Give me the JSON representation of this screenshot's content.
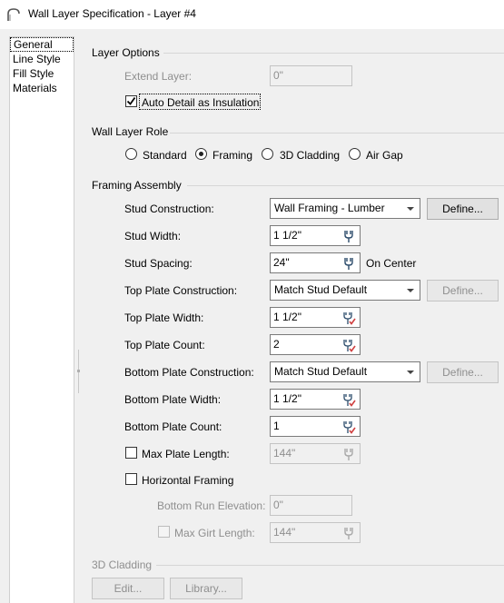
{
  "window": {
    "title": "Wall Layer Specification - Layer #4"
  },
  "nav": {
    "items": [
      "General",
      "Line Style",
      "Fill Style",
      "Materials"
    ],
    "selected": "General"
  },
  "layer_options": {
    "title": "Layer Options",
    "extend_layer_label": "Extend Layer:",
    "extend_layer_value": "0\"",
    "auto_detail_label": "Auto Detail as Insulation",
    "auto_detail_checked": true
  },
  "wall_layer_role": {
    "title": "Wall Layer Role",
    "options": [
      "Standard",
      "Framing",
      "3D Cladding",
      "Air Gap"
    ],
    "selected": "Framing"
  },
  "framing_assembly": {
    "title": "Framing Assembly",
    "stud_construction_label": "Stud Construction:",
    "stud_construction_value": "Wall Framing - Lumber",
    "define_label": "Define...",
    "stud_width_label": "Stud Width:",
    "stud_width_value": "1 1/2\"",
    "stud_spacing_label": "Stud Spacing:",
    "stud_spacing_value": "24\"",
    "on_center_label": "On Center",
    "top_plate_construction_label": "Top Plate Construction:",
    "top_plate_construction_value": "Match Stud Default",
    "top_plate_width_label": "Top Plate Width:",
    "top_plate_width_value": "1 1/2\"",
    "top_plate_count_label": "Top Plate Count:",
    "top_plate_count_value": "2",
    "bottom_plate_construction_label": "Bottom Plate Construction:",
    "bottom_plate_construction_value": "Match Stud Default",
    "bottom_plate_width_label": "Bottom Plate Width:",
    "bottom_plate_width_value": "1 1/2\"",
    "bottom_plate_count_label": "Bottom Plate Count:",
    "bottom_plate_count_value": "1",
    "max_plate_length_label": "Max Plate Length:",
    "max_plate_length_value": "144\"",
    "horizontal_framing_label": "Horizontal Framing",
    "bottom_run_elevation_label": "Bottom Run Elevation:",
    "bottom_run_elevation_value": "0\"",
    "max_girt_length_label": "Max Girt Length:",
    "max_girt_length_value": "144\""
  },
  "cladding": {
    "title": "3D Cladding",
    "edit_label": "Edit...",
    "library_label": "Library..."
  },
  "icons": {
    "app": "arch-icon",
    "ruler": "caliper-icon",
    "ruler_check": "caliper-check-icon"
  },
  "colors": {
    "check_mark": "#d04040"
  }
}
